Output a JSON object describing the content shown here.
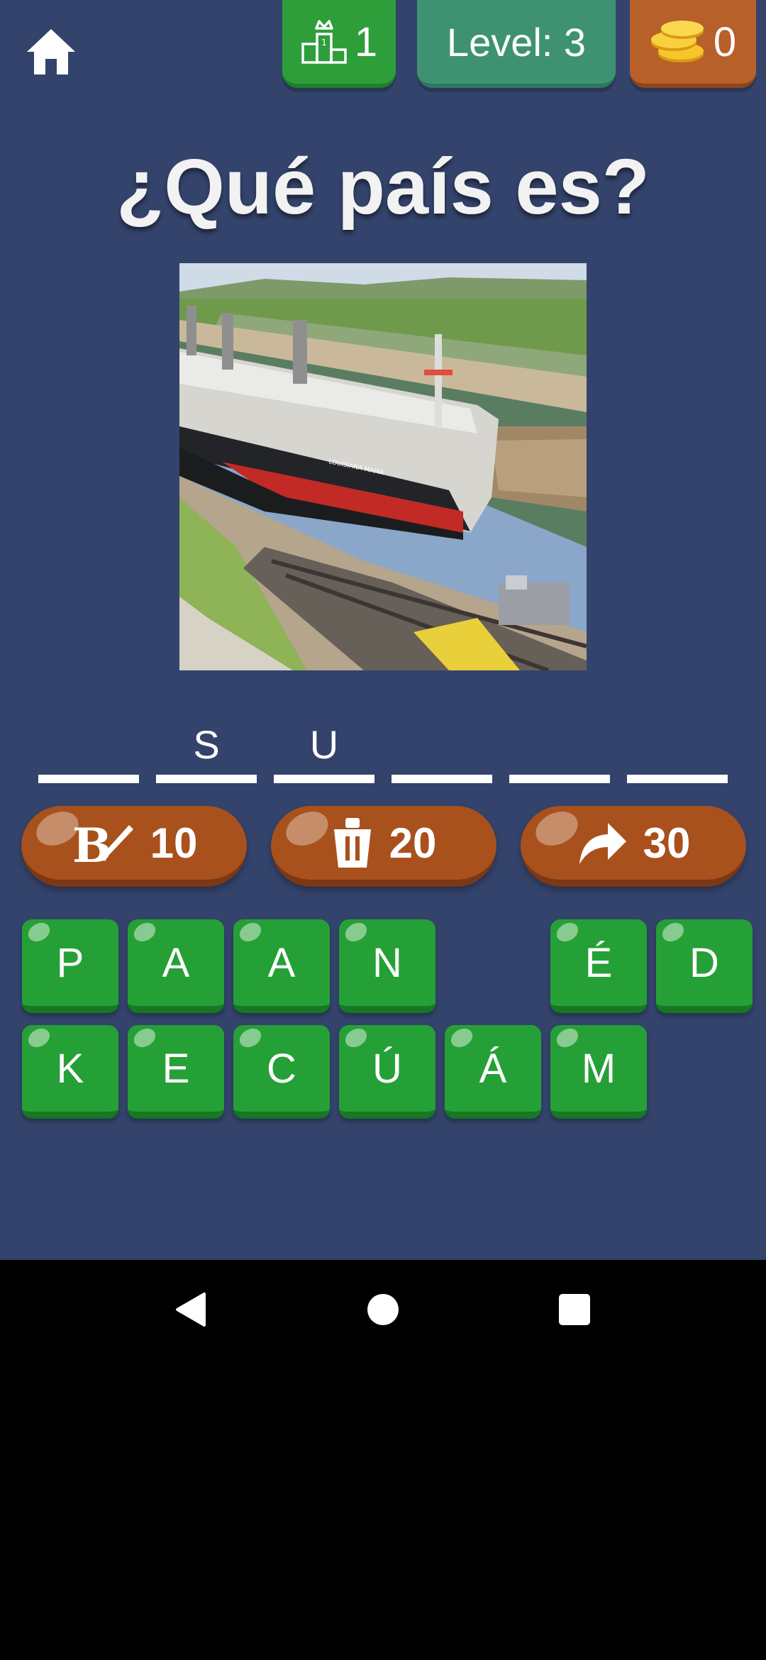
{
  "header": {
    "rank_value": "1",
    "level_text": "Level: 3",
    "coins_value": "0",
    "icons": [
      "home-icon",
      "podium-icon",
      "coins-icon"
    ]
  },
  "question": "¿Qué país es?",
  "photo": {
    "ship_name": "LOUISIANA MAMA"
  },
  "answer_slots": [
    {
      "letter": ""
    },
    {
      "letter": "S"
    },
    {
      "letter": "U"
    },
    {
      "letter": ""
    },
    {
      "letter": ""
    },
    {
      "letter": ""
    }
  ],
  "hints": [
    {
      "icon": "reveal-letter-icon",
      "cost": "10"
    },
    {
      "icon": "trash-icon",
      "cost": "20"
    },
    {
      "icon": "skip-arrow-icon",
      "cost": "30"
    }
  ],
  "tiles_row1": [
    "P",
    "A",
    "A",
    "N",
    "",
    "É",
    "D"
  ],
  "tiles_row2": [
    "K",
    "E",
    "C",
    "Ú",
    "Á",
    "M"
  ],
  "colors": {
    "background": "#33436b",
    "tile_green": "#25a036",
    "hint_brown": "#a8511d",
    "level_tab": "#3e9272",
    "rank_tab": "#2e9e3a",
    "coin_tab": "#b8602a"
  },
  "nav": [
    "back-icon",
    "home-circle-icon",
    "recents-icon"
  ]
}
